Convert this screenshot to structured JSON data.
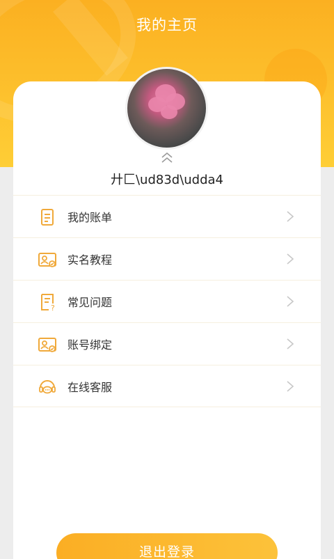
{
  "header": {
    "title": "我的主页"
  },
  "profile": {
    "username": "廾匚\\ud83d\\udda4"
  },
  "menu": {
    "items": [
      {
        "label": "我的账单",
        "icon": "bill-icon"
      },
      {
        "label": "实名教程",
        "icon": "id-card-icon"
      },
      {
        "label": "常见问题",
        "icon": "faq-icon"
      },
      {
        "label": "账号绑定",
        "icon": "id-card-icon"
      },
      {
        "label": "在线客服",
        "icon": "customer-service-icon"
      }
    ]
  },
  "logout": {
    "label": "退出登录"
  },
  "colors": {
    "accent": "#fbb021",
    "icon": "#f0a93a"
  }
}
